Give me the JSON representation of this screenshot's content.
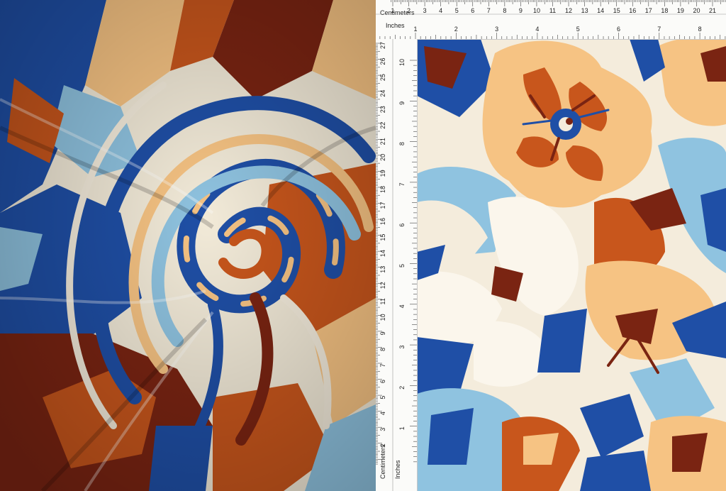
{
  "ruler_top": {
    "centimeters_label": "Centimeters",
    "inches_label": "Inches",
    "cm_numbers": [
      "1",
      "2",
      "3",
      "4",
      "5",
      "6",
      "7",
      "8",
      "9",
      "10",
      "11",
      "12",
      "13",
      "14",
      "15",
      "16",
      "17",
      "18",
      "19",
      "20",
      "21"
    ],
    "inch_numbers": [
      "1",
      "2",
      "3",
      "4",
      "5",
      "6",
      "7",
      "8"
    ]
  },
  "ruler_left": {
    "centimeters_label": "Centimeters",
    "inches_label": "Inches",
    "cm_numbers": [
      "27",
      "26",
      "25",
      "24",
      "23",
      "22",
      "21",
      "20",
      "19",
      "18",
      "17",
      "16",
      "15",
      "14",
      "13",
      "12",
      "11",
      "10",
      "9",
      "8",
      "7",
      "6",
      "5",
      "4",
      "3",
      "2",
      "1"
    ],
    "inch_numbers": [
      "10",
      "9",
      "8",
      "7",
      "6",
      "5",
      "4",
      "3",
      "2",
      "1"
    ]
  },
  "palette": {
    "cream": "#f4ecdc",
    "royal_blue": "#1f4fa6",
    "sky_blue": "#8fc3e0",
    "burnt_orange": "#c8561c",
    "peach": "#f6c383",
    "maroon": "#7a2412"
  }
}
